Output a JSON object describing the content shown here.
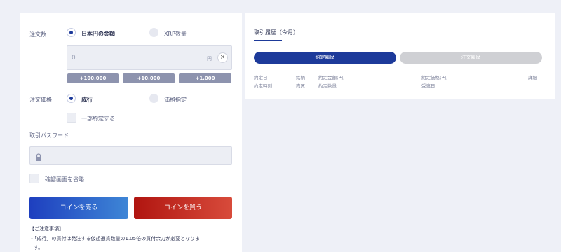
{
  "order_form": {
    "quantity_label": "注文数",
    "option_jpy_amount": "日本円の金額",
    "option_xrp_quantity": "XRP数量",
    "amount_value": "0",
    "amount_unit": "円",
    "quick_add": [
      "+100,000",
      "+10,000",
      "+1,000"
    ],
    "order_type_label": "注文価格",
    "option_market": "成行",
    "option_limit": "価格指定",
    "partial_fill_label": "一部約定する",
    "password_label": "取引パスワード",
    "skip_confirm_label": "確認画面を省略",
    "sell_button": "コインを売る",
    "buy_button": "コインを買う",
    "notes_heading": "【ご注意事項】",
    "notes_text": "・「成行」の買付は発注する仮想通貨数量の1.05倍の買付余力が必要となりま",
    "notes_text_2": "す。"
  },
  "history": {
    "title": "取引履歴（今月）",
    "tab_executions": "約定履歴",
    "tab_orders": "注文履歴",
    "headers_row1": [
      "約定日",
      "銘柄",
      "約定金額(円)",
      "約定価格(円)",
      "詳細"
    ],
    "headers_row2": [
      "約定時刻",
      "売買",
      "約定数量",
      "受渡日"
    ]
  },
  "colors": {
    "accent": "#1d3a9a",
    "sell": "#1e3fbf",
    "buy": "#b01510",
    "chip": "#8d93ae",
    "background": "#eef0f7"
  }
}
